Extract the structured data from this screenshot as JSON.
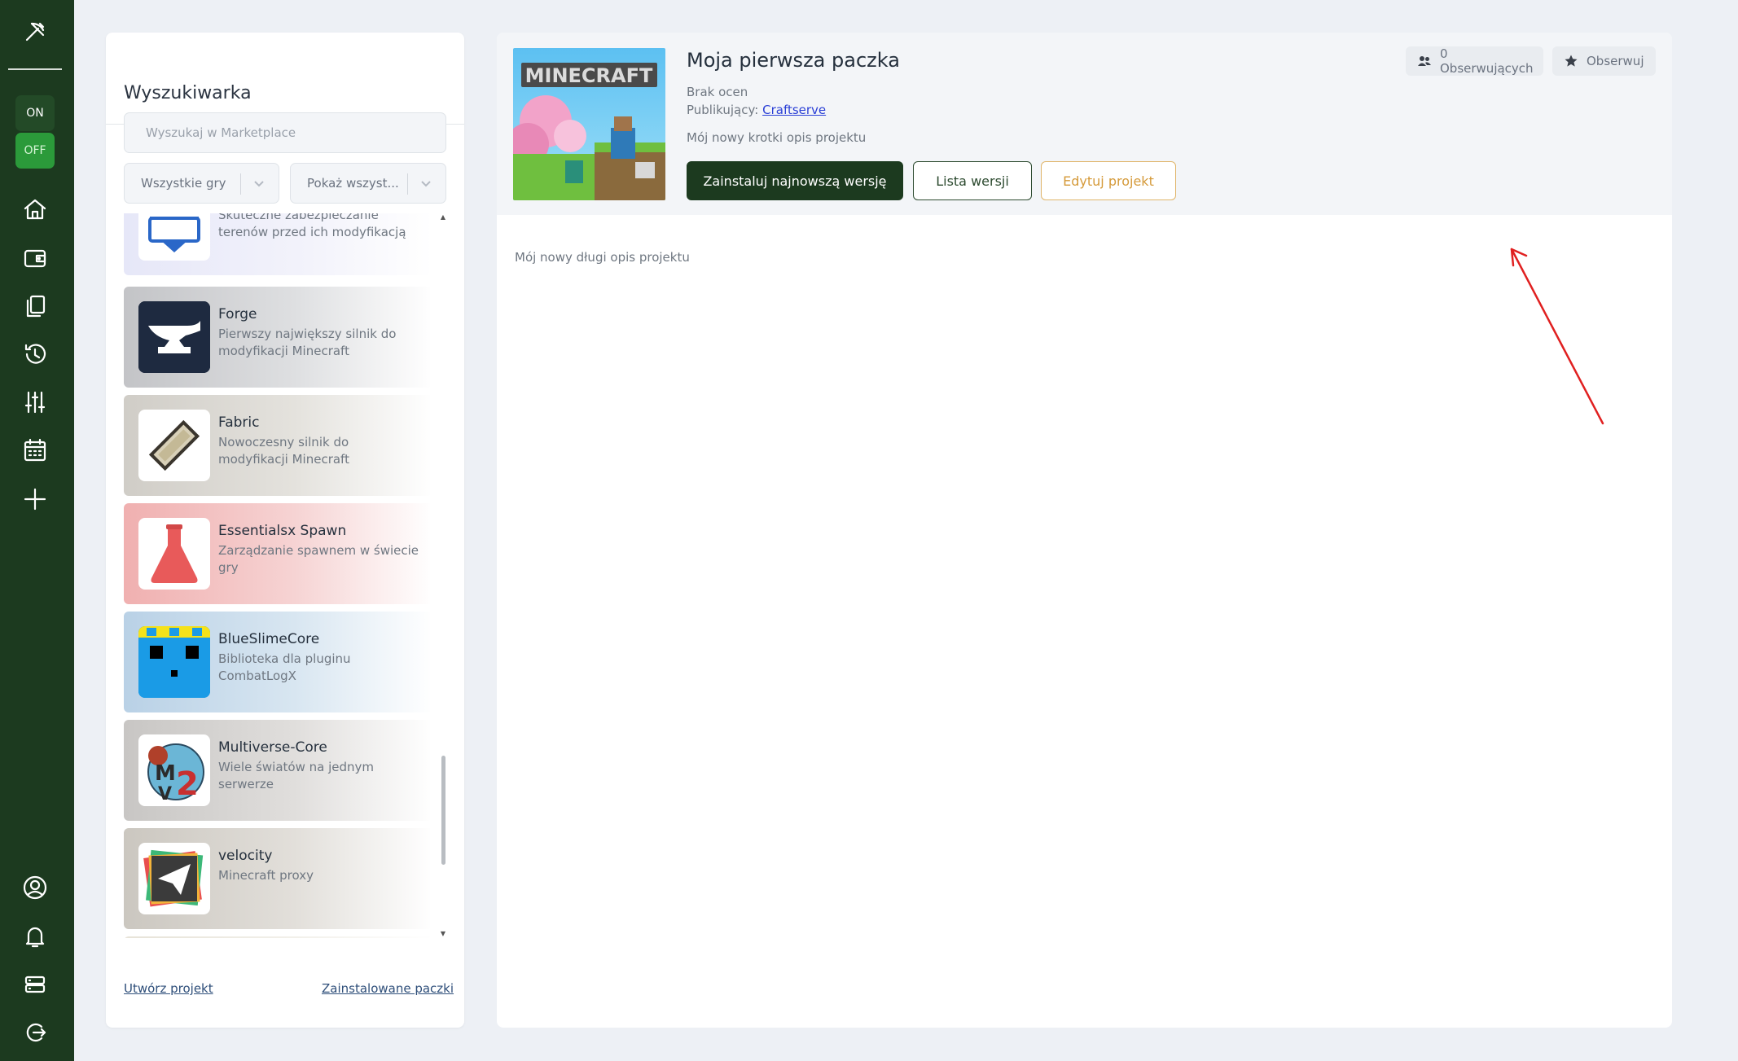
{
  "rail": {
    "on_label": "ON",
    "off_label": "OFF",
    "nav_icons": [
      "home-icon",
      "wallet-icon",
      "copy-icon",
      "history-icon",
      "sliders-icon",
      "calendar-icon",
      "plus-icon"
    ],
    "bottom_icons": [
      "user-icon",
      "bell-icon",
      "server-icon",
      "logout-icon"
    ]
  },
  "search": {
    "title": "Wyszukiwarka",
    "placeholder": "Wyszukaj w Marketplace",
    "games_select": "Wszystkie gry",
    "show_select": "Pokaż wszyst...",
    "items": [
      {
        "name": "",
        "desc": "Skuteczne zabezpieczanie terenów przed ich modyfikacją",
        "icon": "shield-icon",
        "tint": "#e8e9f7"
      },
      {
        "name": "Forge",
        "desc": "Pierwszy największy silnik do modyfikacji Minecraft",
        "icon": "anvil-icon",
        "tint": "#c9cacd"
      },
      {
        "name": "Fabric",
        "desc": "Nowoczesny silnik do modyfikacji Minecraft",
        "icon": "fabric-icon",
        "tint": "#d4d1cb"
      },
      {
        "name": "Essentialsx Spawn",
        "desc": "Zarządzanie spawnem w świecie gry",
        "icon": "flask-icon",
        "tint": "#f1b6b6"
      },
      {
        "name": "BlueSlimeCore",
        "desc": "Biblioteka dla pluginu CombatLogX",
        "icon": "slime-icon",
        "tint": "#c2d7e8"
      },
      {
        "name": "Multiverse-Core",
        "desc": "Wiele światów na jednym serwerze",
        "icon": "mv2-icon",
        "tint": "#cdcbc9"
      },
      {
        "name": "velocity",
        "desc": "Minecraft proxy",
        "icon": "paper-plane-icon",
        "tint": "#cfcbc4"
      }
    ],
    "create_link": "Utwórz projekt",
    "installed_link": "Zainstalowane paczki"
  },
  "project": {
    "cover_text": "MINECRAFT",
    "title": "Moja pierwsza paczka",
    "ratings": "Brak ocen",
    "publisher_label": "Publikujący:",
    "publisher_name": "Craftserve",
    "short_desc": "Mój nowy krotki opis projektu",
    "install_button": "Zainstaluj najnowszą wersję",
    "versions_button": "Lista wersji",
    "edit_button": "Edytuj projekt",
    "followers_chip": "0 Obserwujących",
    "follow_button": "Obserwuj",
    "long_desc": "Mój nowy długi opis projektu"
  },
  "colors": {
    "rail": "#1c3a1f",
    "primary": "#1c3a1f",
    "edit_accent": "#d59a3a",
    "annotation": "#e02020"
  }
}
